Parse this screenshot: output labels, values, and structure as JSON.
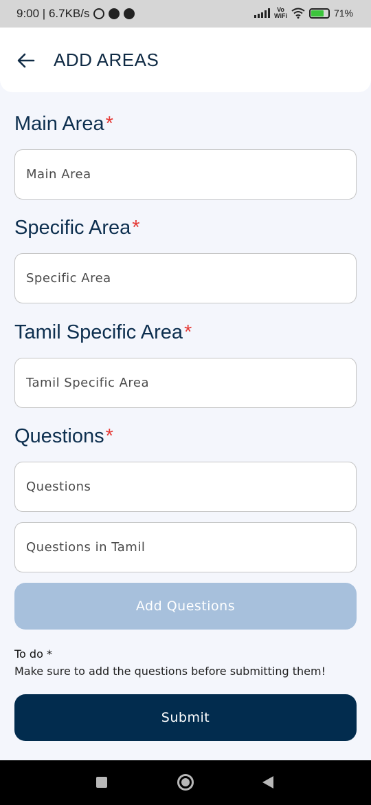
{
  "status_bar": {
    "time_speed": "9:00 | 6.7KB/s",
    "vo_top": "Vo",
    "vo_bottom": "WiFi",
    "battery": "71",
    "battery_unit": "%"
  },
  "header": {
    "title": "ADD AREAS",
    "back_icon": "arrow-left-icon"
  },
  "sections": {
    "main_area": {
      "label": "Main Area",
      "placeholder": "Main Area"
    },
    "specific_area": {
      "label": "Specific Area",
      "placeholder": "Specific Area"
    },
    "tamil_specific_area": {
      "label": "Tamil Specific Area",
      "placeholder": "Tamil Specific Area"
    },
    "questions": {
      "label": "Questions",
      "placeholder": "Questions",
      "placeholder_tamil": "Questions in Tamil"
    },
    "required_mark": "*"
  },
  "actions": {
    "add_questions": "Add Questions",
    "submit": "Submit"
  },
  "todo": {
    "title": "To do *",
    "text": "Make sure to add the questions before submitting them!"
  },
  "colors": {
    "primary": "#022c4e",
    "disabled_button": "#a7c0dc",
    "required": "#e53935",
    "background": "#f4f6fc"
  }
}
